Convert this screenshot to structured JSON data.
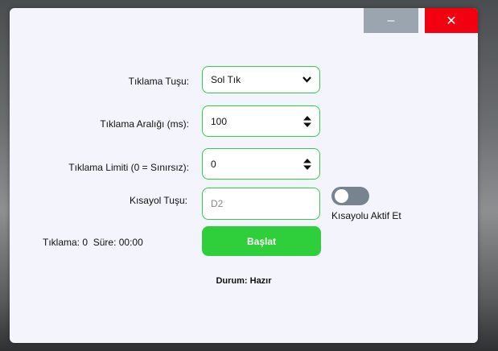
{
  "window": {
    "minimize_glyph": "–",
    "close_glyph": "✕"
  },
  "form": {
    "click_key_label": "Tıklama Tuşu:",
    "click_key_value": "Sol Tık",
    "interval_label": "Tıklama Aralığı (ms):",
    "interval_value": "100",
    "limit_label": "Tıklama Limiti (0 = Sınırsız):",
    "limit_value": "0",
    "hotkey_label": "Kısayol Tuşu:",
    "hotkey_placeholder": "D2"
  },
  "hotkey_toggle": {
    "label": "Kısayolu Aktif Et",
    "on": false
  },
  "stats": {
    "clicks_label": "Tıklama:",
    "clicks_value": "0",
    "time_label": "Süre:",
    "time_value": "00:00"
  },
  "start_button": {
    "label": "Başlat"
  },
  "status": {
    "label": "Durum:",
    "value": "Hazır"
  },
  "colors": {
    "accent": "#2ecf3a",
    "close": "#f2000f",
    "minimize": "#9aa5b0",
    "toggle_off": "#778490"
  },
  "icons": {
    "minimize": "minimize-icon",
    "close": "close-icon",
    "dropdown": "chevron-down-icon",
    "spinner": "spinner-arrows-icon"
  }
}
